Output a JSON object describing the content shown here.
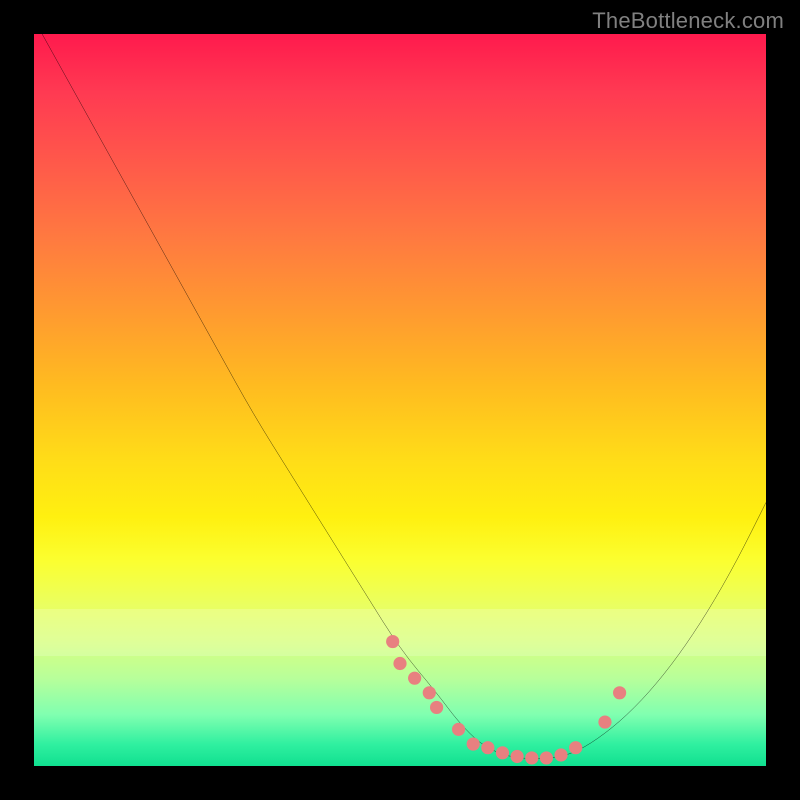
{
  "watermark": "TheBottleneck.com",
  "chart_data": {
    "type": "line",
    "title": "",
    "xlabel": "",
    "ylabel": "",
    "xlim": [
      0,
      100
    ],
    "ylim": [
      0,
      100
    ],
    "series": [
      {
        "name": "bottleneck-curve",
        "x": [
          0,
          5,
          10,
          15,
          20,
          25,
          30,
          35,
          40,
          45,
          50,
          55,
          58,
          61,
          64,
          67,
          70,
          73,
          76,
          80,
          84,
          88,
          92,
          96,
          100
        ],
        "values": [
          102,
          93,
          84,
          75,
          66,
          57,
          48,
          40,
          32,
          24,
          16,
          10,
          6,
          3,
          1.5,
          1,
          1,
          1.5,
          3,
          6,
          10,
          15,
          21,
          28,
          36
        ]
      }
    ],
    "markers": {
      "name": "highlight-dots",
      "color": "#e88080",
      "x": [
        49,
        50,
        52,
        54,
        55,
        58,
        60,
        62,
        64,
        66,
        68,
        70,
        72,
        74,
        78,
        80
      ],
      "values": [
        17,
        14,
        12,
        10,
        8,
        5,
        3,
        2.5,
        1.8,
        1.3,
        1.1,
        1.1,
        1.5,
        2.5,
        6,
        10
      ]
    },
    "background": {
      "type": "vertical-gradient",
      "stops": [
        {
          "pos": 0,
          "color": "#ff1a4d"
        },
        {
          "pos": 50,
          "color": "#ffdc18"
        },
        {
          "pos": 100,
          "color": "#10e090"
        }
      ]
    }
  }
}
